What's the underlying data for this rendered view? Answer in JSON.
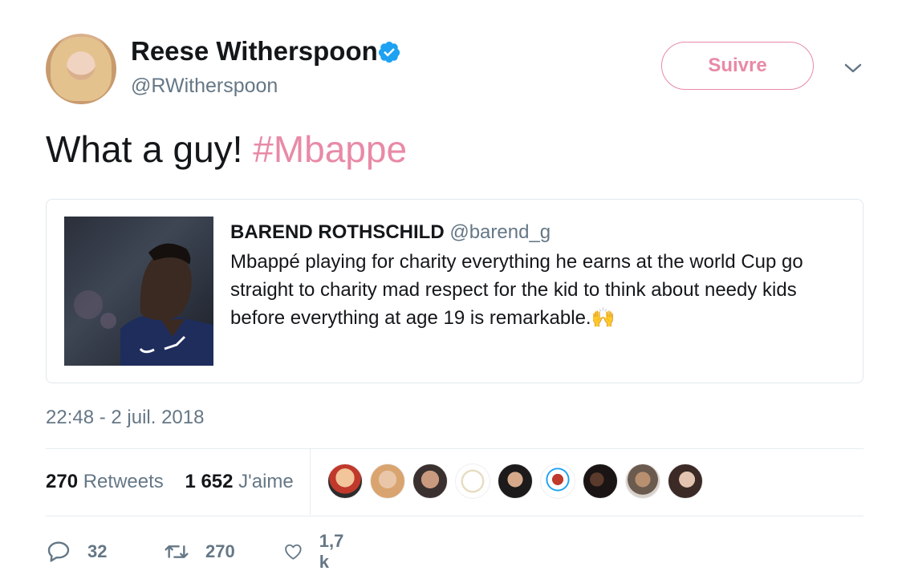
{
  "author": {
    "name": "Reese Witherspoon",
    "handle": "@RWitherspoon",
    "verified": true
  },
  "follow_button": "Suivre",
  "tweet": {
    "text": "What a guy! ",
    "hashtag": "#Mbappe"
  },
  "quoted_tweet": {
    "name": "BAREND ROTHSCHILD",
    "handle": "@barend_g",
    "text": "Mbappé playing for charity everything he  earns at the world Cup go straight to charity mad respect for the kid to think about needy kids before everything at age 19 is remarkable.🙌"
  },
  "timestamp": "22:48 - 2 juil. 2018",
  "stats": {
    "retweets_count": "270",
    "retweets_label": "Retweets",
    "likes_count": "1 652",
    "likes_label": "J'aime"
  },
  "actions": {
    "reply_count": "32",
    "retweet_count": "270",
    "like_count": "1,7 k"
  },
  "colors": {
    "accent": "#e88aa6",
    "verified": "#1da1f2",
    "secondary_text": "#657786"
  },
  "icons": [
    "verified-badge-icon",
    "chevron-down-icon",
    "reply-icon",
    "retweet-icon",
    "heart-icon"
  ]
}
